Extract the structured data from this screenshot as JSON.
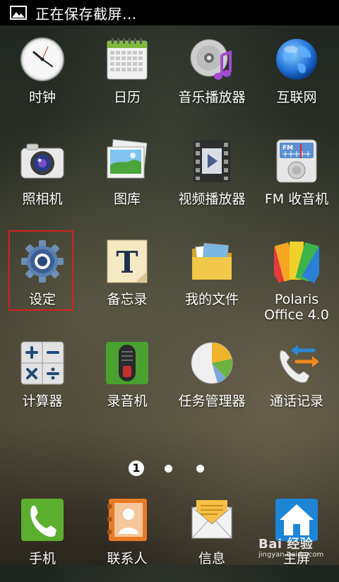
{
  "status_bar": {
    "notification_icon": "image-icon",
    "text": "正在保存截屏..."
  },
  "apps": [
    {
      "label": "时钟",
      "icon": "clock-icon"
    },
    {
      "label": "日历",
      "icon": "calendar-icon"
    },
    {
      "label": "音乐播放器",
      "icon": "music-player-icon"
    },
    {
      "label": "互联网",
      "icon": "globe-icon"
    },
    {
      "label": "照相机",
      "icon": "camera-icon"
    },
    {
      "label": "图库",
      "icon": "gallery-icon"
    },
    {
      "label": "视频播放器",
      "icon": "video-player-icon"
    },
    {
      "label": "FM 收音机",
      "icon": "fm-radio-icon"
    },
    {
      "label": "设定",
      "icon": "gear-icon",
      "selected": true
    },
    {
      "label": "备忘录",
      "icon": "memo-icon"
    },
    {
      "label": "我的文件",
      "icon": "folder-icon"
    },
    {
      "label": "Polaris\nOffice 4.0",
      "icon": "polaris-office-icon"
    },
    {
      "label": "计算器",
      "icon": "calculator-icon"
    },
    {
      "label": "录音机",
      "icon": "voice-recorder-icon"
    },
    {
      "label": "任务管理器",
      "icon": "task-manager-icon"
    },
    {
      "label": "通话记录",
      "icon": "call-log-icon"
    }
  ],
  "page_indicator": {
    "current_page": "1",
    "total_pages": 3
  },
  "dock": [
    {
      "label": "手机",
      "icon": "phone-icon"
    },
    {
      "label": "联系人",
      "icon": "contacts-icon"
    },
    {
      "label": "信息",
      "icon": "messages-icon"
    },
    {
      "label": "主屏",
      "icon": "home-icon"
    }
  ],
  "watermark": {
    "main": "Bai 经验",
    "sub": "jingyan.baidu.com"
  },
  "colors": {
    "selection_border": "#d62020"
  }
}
